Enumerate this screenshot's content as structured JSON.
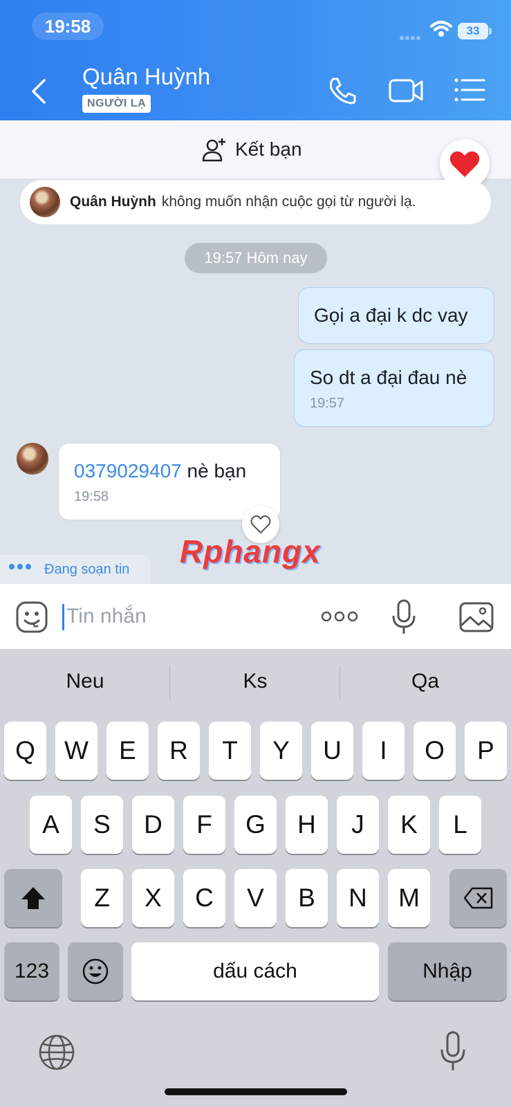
{
  "status_bar": {
    "time": "19:58",
    "battery": "33"
  },
  "header": {
    "contact_name": "Quân Huỳnh",
    "badge": "NGƯỜI LẠ",
    "icons": [
      "back-icon",
      "phone-icon",
      "video-call-icon",
      "menu-list-icon"
    ]
  },
  "add_friend": {
    "label": "Kết bạn"
  },
  "notice": {
    "name": "Quân Huỳnh",
    "text": "không muốn nhận cuộc gọi từ người lạ."
  },
  "chat": {
    "date_separator": "19:57 Hôm nay",
    "messages": [
      {
        "direction": "out",
        "text": "Gọi a đại k dc vay"
      },
      {
        "direction": "out",
        "text": "So dt a đại đau nè",
        "time": "19:57"
      },
      {
        "direction": "in",
        "phone": "0379029407",
        "text": " nè bạn",
        "time": "19:58"
      }
    ]
  },
  "watermark": "Rphangx",
  "typing_indicator": "Đang soạn tin",
  "composer": {
    "placeholder": "Tin nhắn"
  },
  "keyboard": {
    "suggestions": [
      "Neu",
      "Ks",
      "Qa"
    ],
    "row1": [
      "Q",
      "W",
      "E",
      "R",
      "T",
      "Y",
      "U",
      "I",
      "O",
      "P"
    ],
    "row2": [
      "A",
      "S",
      "D",
      "F",
      "G",
      "H",
      "J",
      "K",
      "L"
    ],
    "row3": [
      "Z",
      "X",
      "C",
      "V",
      "B",
      "N",
      "M"
    ],
    "numbers_key": "123",
    "space_key": "dấu cách",
    "return_key": "Nhập"
  },
  "colors": {
    "header_blue": "#3d8ef3",
    "outgoing_bubble": "#dcefff",
    "link": "#3a8ae4"
  }
}
